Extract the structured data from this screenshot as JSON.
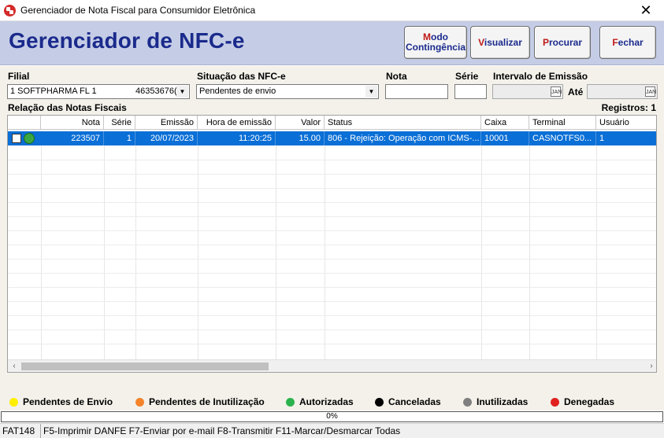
{
  "window": {
    "title": "Gerenciador de Nota Fiscal para Consumidor Eletrônica",
    "close_glyph": "✕"
  },
  "header": {
    "title": "Gerenciador de NFC-e",
    "buttons": {
      "modo_hotkey": "M",
      "modo_rest": "odo",
      "modo_line2": "Contingência",
      "visualizar_hotkey": "V",
      "visualizar_rest": "isualizar",
      "procurar_hotkey": "P",
      "procurar_rest": "rocurar",
      "fechar_hotkey": "F",
      "fechar_rest": "echar"
    }
  },
  "filters": {
    "filial_label": "Filial",
    "filial_value": "1  SOFTPHARMA FL 1",
    "filial_code": "46353676(",
    "situacao_label": "Situação das NFC-e",
    "situacao_value": "Pendentes de envio",
    "nota_label": "Nota",
    "nota_value": "",
    "serie_label": "Série",
    "serie_value": "",
    "intervalo_label": "Intervalo de Emissão",
    "ate_label": "Até",
    "cal_glyph": "JAN"
  },
  "list": {
    "title": "Relação das Notas Fiscais",
    "registros": "Registros: 1",
    "columns": [
      "Nota",
      "Série",
      "Emissão",
      "Hora de emissão",
      "Valor",
      "Status",
      "Caixa",
      "Terminal",
      "Usuário"
    ],
    "rows": [
      {
        "status_color": "#3aa743",
        "nota": "223507",
        "serie": "1",
        "emissao": "20/07/2023",
        "hora": "11:20:25",
        "valor": "15.00",
        "status": "806 - Rejeição: Operação com ICMS-...",
        "caixa": "10001",
        "terminal": "CASNOTFS0...",
        "usuario": "1"
      }
    ],
    "scroll_left": "‹",
    "scroll_right": "›"
  },
  "legend": [
    {
      "label": "Pendentes de Envio",
      "color": "#ffee00"
    },
    {
      "label": "Pendentes de Inutilização",
      "color": "#f5832a"
    },
    {
      "label": "Autorizadas",
      "color": "#2bb24c"
    },
    {
      "label": "Canceladas",
      "color": "#000000"
    },
    {
      "label": "Inutilizadas",
      "color": "#7f7f7f"
    },
    {
      "label": "Denegadas",
      "color": "#e0201f"
    }
  ],
  "progress": {
    "label": "0%",
    "value": 0
  },
  "statusbar": {
    "form_code": "FAT148",
    "shortcuts": "F5-Imprimir DANFE  F7-Enviar por e-mail  F8-Transmitir  F11-Marcar/Desmarcar Todas"
  },
  "colors": {
    "header_band": "#c5cde6",
    "title_blue": "#1a2a8c",
    "selection": "#0a6fd6",
    "hotkey_red": "#c01818"
  }
}
